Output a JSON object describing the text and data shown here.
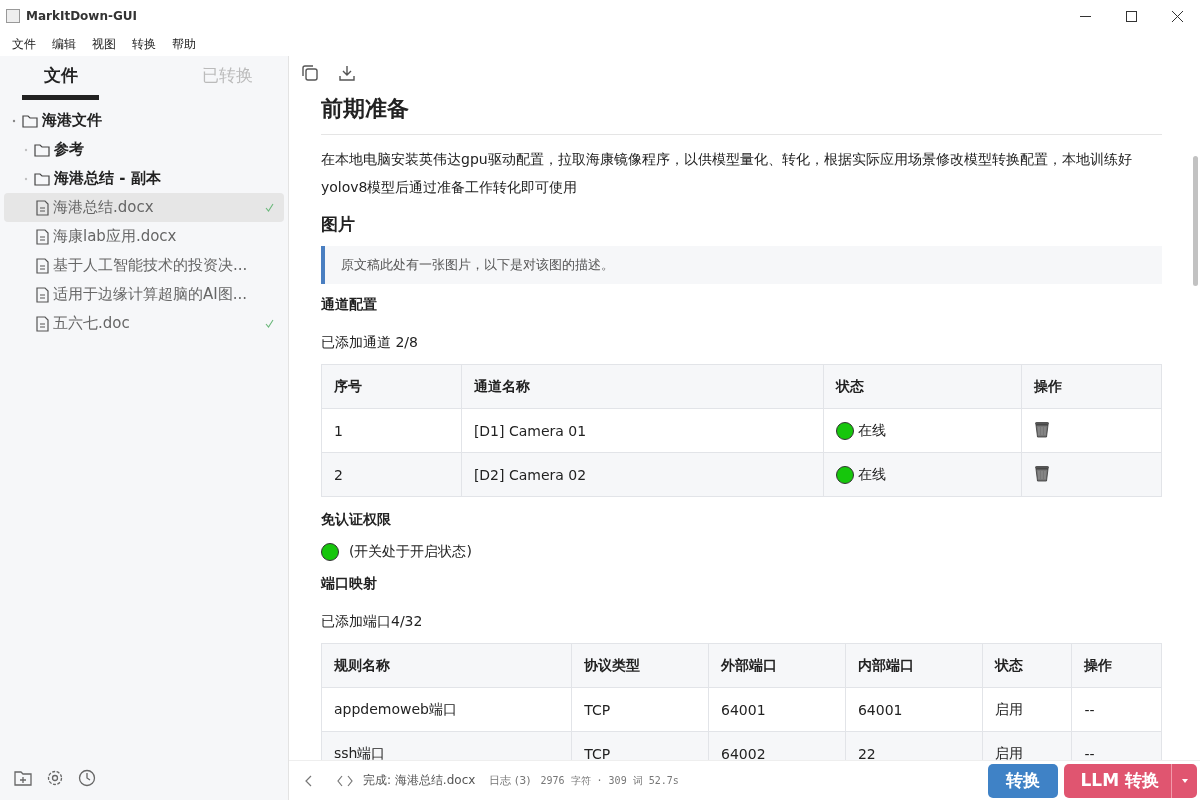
{
  "window": {
    "title": "MarkItDown-GUI"
  },
  "menu": [
    "文件",
    "编辑",
    "视图",
    "转换",
    "帮助"
  ],
  "sidebar": {
    "tabs": [
      {
        "label": "文件",
        "selected": true
      },
      {
        "label": "已转换",
        "selected": false
      }
    ],
    "tree": [
      {
        "kind": "folder",
        "name": "海港文件",
        "expanded": true,
        "children": [
          {
            "kind": "folder",
            "name": "参考",
            "expanded": false
          },
          {
            "kind": "folder",
            "name": "海港总结 - 副本",
            "expanded": false
          },
          {
            "kind": "file",
            "name": "海港总结.docx",
            "selected": true,
            "converted": true
          },
          {
            "kind": "file",
            "name": "海康lab应用.docx",
            "selected": false,
            "converted": false
          },
          {
            "kind": "file",
            "name": "基于人工智能技术的投资决...",
            "selected": false,
            "converted": false
          },
          {
            "kind": "file",
            "name": "适用于边缘计算超脑的AI图...",
            "selected": false,
            "converted": false
          },
          {
            "kind": "file",
            "name": "五六七.doc",
            "selected": false,
            "converted": true
          }
        ]
      }
    ]
  },
  "document": {
    "blocks": [
      {
        "kind": "h1",
        "text": "前期准备"
      },
      {
        "kind": "p",
        "text": "在本地电脑安装英伟达gpu驱动配置，拉取海康镜像程序，以供模型量化、转化，根据实际应用场景修改模型转换配置，本地训练好yolov8模型后通过准备工作转化即可使用"
      },
      {
        "kind": "h2",
        "text": "图片"
      },
      {
        "kind": "quote",
        "text": "原文稿此处有一张图片，以下是对该图的描述。"
      },
      {
        "kind": "h3",
        "text": "通道配置"
      },
      {
        "kind": "p",
        "text": "已添加通道 2/8"
      },
      {
        "kind": "table",
        "columns": [
          "序号",
          "通道名称",
          "状态",
          "操作"
        ],
        "rows": [
          [
            {
              "text": "1"
            },
            {
              "text": "[D1] Camera 01"
            },
            {
              "status": "在线",
              "color": "#16c60c"
            },
            {
              "kind": "trash"
            }
          ],
          [
            {
              "text": "2"
            },
            {
              "text": "[D2] Camera 02"
            },
            {
              "status": "在线",
              "color": "#16c60c"
            },
            {
              "kind": "trash"
            }
          ]
        ]
      },
      {
        "kind": "h3",
        "text": "免认证权限"
      },
      {
        "kind": "status",
        "text": "(开关处于开启状态)",
        "color": "#16c60c"
      },
      {
        "kind": "h3",
        "text": "端口映射"
      },
      {
        "kind": "p",
        "text": "已添加端口4/32"
      },
      {
        "kind": "table",
        "columns": [
          "规则名称",
          "协议类型",
          "外部端口",
          "内部端口",
          "状态",
          "操作"
        ],
        "rows": [
          [
            {
              "text": "appdemoweb端口"
            },
            {
              "text": "TCP"
            },
            {
              "text": "64001"
            },
            {
              "text": "64001"
            },
            {
              "text": "启用"
            },
            {
              "text": "--"
            }
          ],
          [
            {
              "text": "ssh端口"
            },
            {
              "text": "TCP"
            },
            {
              "text": "64002"
            },
            {
              "text": "22"
            },
            {
              "text": "启用"
            },
            {
              "text": "--"
            }
          ]
        ]
      }
    ]
  },
  "status_bar": {
    "message": "完成: 海港总结.docx",
    "log": "日志 (3)",
    "stats": "2976 字符 · 309 词 52.7s"
  },
  "buttons": [
    {
      "kind": "primary",
      "label": "转换"
    },
    {
      "kind": "danger",
      "label": "LLM 转换",
      "dropdown": true
    }
  ]
}
